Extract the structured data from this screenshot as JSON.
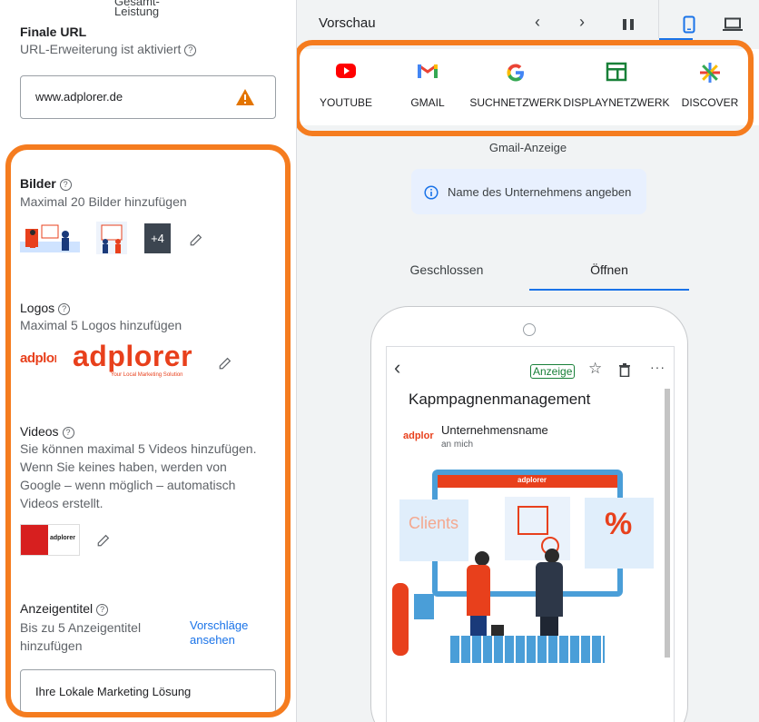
{
  "left": {
    "top_cut_label_1": "Gesamt-",
    "top_cut_label_2": "Leistung",
    "final_url": {
      "title": "Finale URL",
      "subtitle": "URL-Erweiterung ist aktiviert",
      "value": "www.adplorer.de"
    },
    "images": {
      "title": "Bilder",
      "subtitle": "Maximal 20 Bilder hinzufügen",
      "more_count": "+4"
    },
    "logos": {
      "title": "Logos",
      "subtitle": "Maximal 5 Logos hinzufügen",
      "logo_small_text": "adplorer",
      "logo_big_text": "adplorer",
      "logo_tagline": "Your Local Marketing Solution"
    },
    "videos": {
      "title": "Videos",
      "desc_1": "Sie können maximal 5 Videos hinzufügen.",
      "desc_2": "Wenn Sie keines haben, werden von",
      "desc_3": "Google – wenn möglich – automatisch",
      "desc_4": "Videos erstellt.",
      "thumb_text": "adplorer"
    },
    "headlines": {
      "title": "Anzeigentitel",
      "desc_1": "Bis zu 5 Anzeigentitel",
      "desc_2": "hinzufügen",
      "suggest_1": "Vorschläge",
      "suggest_2": "ansehen",
      "value": "Ihre Lokale Marketing Lösung"
    }
  },
  "preview": {
    "title": "Vorschau",
    "channels": [
      {
        "label": "YOUTUBE",
        "icon": "youtube-icon"
      },
      {
        "label": "GMAIL",
        "icon": "gmail-icon"
      },
      {
        "label": "SUCHNETZWERK",
        "icon": "google-icon"
      },
      {
        "label": "DISPLAYNETZWERK",
        "icon": "display-icon"
      },
      {
        "label": "DISCOVER",
        "icon": "discover-icon"
      }
    ],
    "caption": "Gmail-Anzeige",
    "info": "Name des Unternehmens angeben",
    "tabs": [
      "Geschlossen",
      "Öffnen"
    ],
    "active_tab": "Öffnen",
    "phone": {
      "badge": "Anzeige",
      "subject": "Kapmpagnenmanagement",
      "sender_logo": "adplor",
      "sender": "Unternehmensname",
      "to": "an mich",
      "hero_brand": "adplorer",
      "hero_clients": "Clients",
      "hero_percent": "%"
    },
    "colors": {
      "accent": "#1a73e8",
      "highlight": "#f57c1f",
      "brand_red": "#e8401c"
    }
  }
}
